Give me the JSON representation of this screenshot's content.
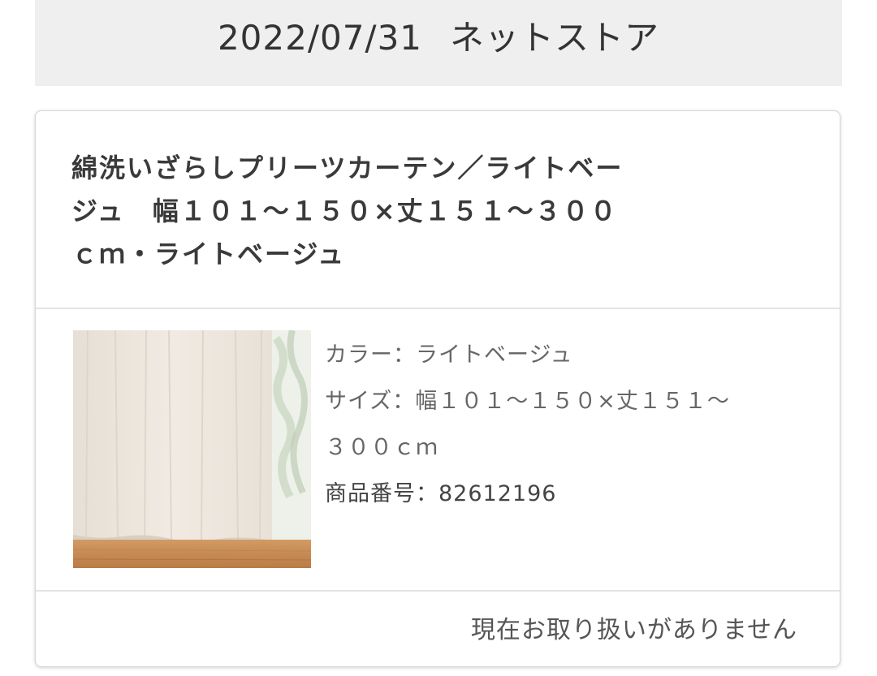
{
  "header": {
    "date": "2022/07/31",
    "store": "ネットストア"
  },
  "product": {
    "title_lines": [
      "綿洗いざらしプリーツカーテン／ライトベー",
      "ジュ　幅１０１～１５０×丈１５１～３００",
      "ｃｍ・ライトベージュ"
    ],
    "image_icon": "curtain-photo",
    "color_label": "カラー：",
    "color_value": "ライトベージュ",
    "size_label": "サイズ：",
    "size_value_line1": "幅１０１～１５０×丈１５１～",
    "size_value_line2": "３００ｃｍ",
    "item_no_label": "商品番号：",
    "item_no_value": "82612196"
  },
  "status": {
    "text": "現在お取り扱いがありません"
  },
  "colors": {
    "header_bg": "#efefef",
    "card_border": "#d6d6d6",
    "divider": "#e4e4e4",
    "curtain": "#ece5dc",
    "floor": "#c98c57"
  }
}
